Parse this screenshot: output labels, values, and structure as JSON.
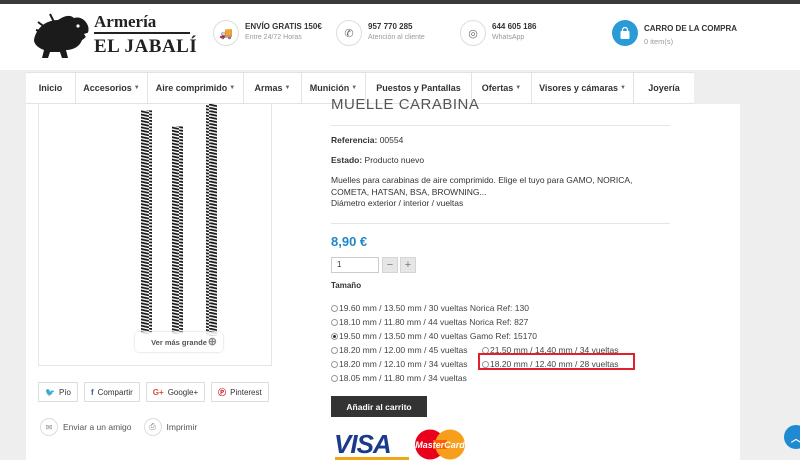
{
  "brand": {
    "line1": "Armería",
    "line2": "EL JABALÍ"
  },
  "header_info": [
    {
      "title": "ENVÍO GRATIS 150€",
      "sub": "Entre 24/72 Horas",
      "icon": "truck-icon"
    },
    {
      "title": "957 770 285",
      "sub": "Atención al cliente",
      "icon": "phone-icon"
    },
    {
      "title": "644 605 186",
      "sub": "WhatsApp",
      "icon": "whatsapp-icon"
    }
  ],
  "cart": {
    "title": "CARRO DE LA COMPRA",
    "count": "0 item(s)"
  },
  "nav": [
    {
      "label": "Inicio",
      "caret": false
    },
    {
      "label": "Accesorios",
      "caret": true
    },
    {
      "label": "Aire comprimido",
      "caret": true
    },
    {
      "label": "Armas",
      "caret": true
    },
    {
      "label": "Munición",
      "caret": true
    },
    {
      "label": "Puestos y Pantallas",
      "caret": false
    },
    {
      "label": "Ofertas",
      "caret": true
    },
    {
      "label": "Visores y cámaras",
      "caret": true
    },
    {
      "label": "Joyería",
      "caret": false
    }
  ],
  "product": {
    "title": "MUELLE CARABINA",
    "reference_label": "Referencia:",
    "reference_value": "00554",
    "state_label": "Estado:",
    "state_value": "Producto nuevo",
    "description": [
      "Muelles para carabinas de aire comprimido. Elige el tuyo para GAMO, NORICA,",
      "COMETA, HATSAN, BSA, BROWNING...",
      "Diámetro exterior / interior / vueltas"
    ],
    "price": "8,90 €",
    "quantity": "1",
    "size_label": "Tamaño",
    "zoom_label": "Ver más grande",
    "add_to_cart": "Añadir al carrito"
  },
  "sizes": [
    {
      "label": "19.60 mm / 13.50 mm / 30 vueltas Norica Ref: 130",
      "selected": false
    },
    {
      "label": "18.10 mm / 11.80 mm / 44 vueltas Norica Ref: 827",
      "selected": false
    },
    {
      "label": "19.50 mm / 13.50 mm / 40 vueltas Gamo Ref: 15170",
      "selected": true
    },
    {
      "label": "18.20 mm / 12.00 mm / 45 vueltas",
      "selected": false
    },
    {
      "label": "21.50 mm / 14.40 mm / 34 vueltas",
      "selected": false
    },
    {
      "label": "18.20 mm / 12.10 mm / 34 vueltas",
      "selected": false
    },
    {
      "label": "18.20 mm / 12.40 mm / 28 vueltas",
      "selected": false
    },
    {
      "label": "18.05 mm / 11.80 mm / 34 vueltas",
      "selected": false
    }
  ],
  "share": [
    {
      "label": "Pío",
      "icon": "twitter-icon",
      "glyph": "🐦",
      "color": "#1da1f2"
    },
    {
      "label": "Compartir",
      "icon": "facebook-icon",
      "glyph": "f",
      "color": "#3b5998"
    },
    {
      "label": "Google+",
      "icon": "google-plus-icon",
      "glyph": "G+",
      "color": "#dd4b39"
    },
    {
      "label": "Pinterest",
      "icon": "pinterest-icon",
      "glyph": "P",
      "color": "#cb2027"
    }
  ],
  "links": [
    {
      "label": "Enviar a un amigo",
      "icon": "envelope-icon",
      "glyph": "✉"
    },
    {
      "label": "Imprimir",
      "icon": "print-icon",
      "glyph": "⎙"
    }
  ],
  "payment": {
    "visa": "VISA",
    "mastercard": "MasterCard"
  },
  "colors": {
    "accent": "#1e88c9",
    "highlight": "#e0202a"
  }
}
